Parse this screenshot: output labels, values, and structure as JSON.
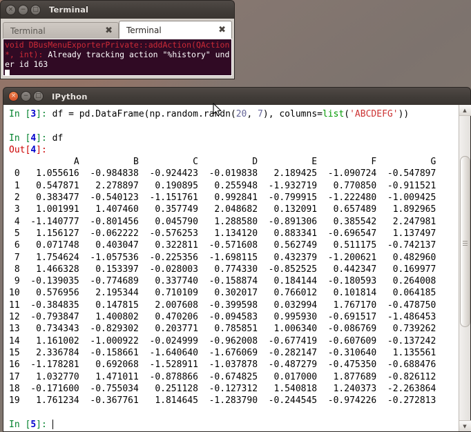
{
  "desktop": {
    "accent_orange": "#d4512a",
    "terminal_bg": "#300a24"
  },
  "terminal_window": {
    "title": "Terminal",
    "buttons": {
      "close": "×",
      "minimize": "−",
      "maximize": "□"
    },
    "tabs": [
      {
        "label": "Terminal",
        "close": "✖",
        "active": false
      },
      {
        "label": "Terminal",
        "close": "✖",
        "active": true
      }
    ],
    "output": {
      "error_prefix": "void DBusMenuExporterPrivate::addAction(QAction*, int): ",
      "message": "Already tracking action \"%history\" under id 163"
    }
  },
  "ipython_window": {
    "title": "IPython",
    "buttons": {
      "close": "×",
      "minimize": "−",
      "maximize": "□"
    },
    "prompts": {
      "in3_label": "In [",
      "in3_num": "3",
      "in3_close": "]: ",
      "in4_num": "4",
      "out4_num": "4",
      "in5_num": "5"
    },
    "cell_in3": {
      "code_a": "df = pd.DataFrame(np.random.randn(",
      "arg_rows": "20",
      "comma": ", ",
      "arg_cols": "7",
      "code_b": "), columns=",
      "builtin": "list",
      "paren_open": "(",
      "string": "'ABCDEFG'",
      "paren_close": "))"
    },
    "cell_in4": {
      "code": "df"
    },
    "out4_label": "Out[",
    "out4_close": "]: ",
    "scrollbar": {
      "up_arrow": "▲",
      "down_arrow": "▼"
    }
  },
  "chart_data": {
    "type": "table",
    "title": "df",
    "index_name": "",
    "columns": [
      "A",
      "B",
      "C",
      "D",
      "E",
      "F",
      "G"
    ],
    "index": [
      "0",
      "1",
      "2",
      "3",
      "4",
      "5",
      "6",
      "7",
      "8",
      "9",
      "10",
      "11",
      "12",
      "13",
      "14",
      "15",
      "16",
      "17",
      "18",
      "19"
    ],
    "rows": [
      [
        "1.055616",
        "-0.984838",
        "-0.924423",
        "-0.019838",
        "2.189425",
        "-1.090724",
        "-0.547897"
      ],
      [
        "0.547871",
        "2.278897",
        "0.190895",
        "0.255948",
        "-1.932719",
        "0.770850",
        "-0.911521"
      ],
      [
        "0.383477",
        "-0.540123",
        "-1.151761",
        "0.992841",
        "-0.799915",
        "-1.222480",
        "-1.009425"
      ],
      [
        "1.001991",
        "1.407460",
        "0.357749",
        "2.048682",
        "0.132091",
        "0.657489",
        "1.892965"
      ],
      [
        "-1.140777",
        "-0.801456",
        "0.045790",
        "1.288580",
        "-0.891306",
        "0.385542",
        "2.247981"
      ],
      [
        "1.156127",
        "-0.062222",
        "-0.576253",
        "1.134120",
        "0.883341",
        "-0.696547",
        "1.137497"
      ],
      [
        "0.071748",
        "0.403047",
        "0.322811",
        "-0.571608",
        "0.562749",
        "0.511175",
        "-0.742137"
      ],
      [
        "1.754624",
        "-1.057536",
        "-0.225356",
        "-1.698115",
        "0.432379",
        "-1.200621",
        "0.482960"
      ],
      [
        "1.466328",
        "0.153397",
        "-0.028003",
        "0.774330",
        "-0.852525",
        "0.442347",
        "0.169977"
      ],
      [
        "-0.139035",
        "-0.774689",
        "0.337740",
        "-0.158874",
        "0.184144",
        "-0.180593",
        "0.264008"
      ],
      [
        "0.576956",
        "2.195344",
        "0.710109",
        "0.302017",
        "0.766012",
        "0.101814",
        "0.064185"
      ],
      [
        "-0.384835",
        "0.147815",
        "2.007608",
        "-0.399598",
        "0.032994",
        "1.767170",
        "-0.478750"
      ],
      [
        "-0.793847",
        "1.400802",
        "0.470206",
        "-0.094583",
        "0.995930",
        "-0.691517",
        "-1.486453"
      ],
      [
        "0.734343",
        "-0.829302",
        "0.203771",
        "0.785851",
        "1.006340",
        "-0.086769",
        "0.739262"
      ],
      [
        "1.161002",
        "-1.000922",
        "-0.024999",
        "-0.962008",
        "-0.677419",
        "-0.607609",
        "-0.137242"
      ],
      [
        "2.336784",
        "-0.158661",
        "-1.640640",
        "-1.676069",
        "-0.282147",
        "-0.310640",
        "1.135561"
      ],
      [
        "-1.178281",
        "0.692068",
        "-1.528911",
        "-1.037878",
        "-0.487279",
        "-0.475350",
        "-0.688476"
      ],
      [
        "1.032770",
        "1.471011",
        "-0.878866",
        "-0.674825",
        "0.017000",
        "1.877689",
        "-0.826112"
      ],
      [
        "-0.171600",
        "-0.755034",
        "0.251128",
        "-0.127312",
        "1.540818",
        "1.240373",
        "-2.263864"
      ],
      [
        "1.761234",
        "-0.367761",
        "1.814645",
        "-1.283790",
        "-0.244545",
        "-0.974226",
        "-0.272813"
      ]
    ]
  }
}
